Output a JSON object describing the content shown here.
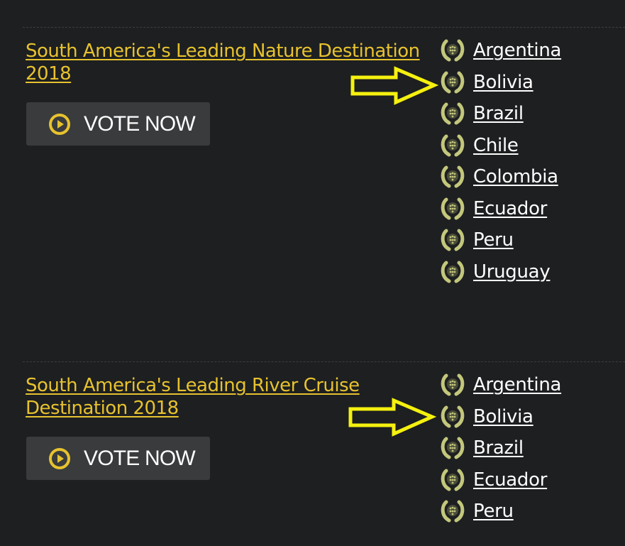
{
  "awards": [
    {
      "title": "South America's Leading Nature Destination 2018",
      "vote_label": "VOTE NOW",
      "countries": [
        "Argentina",
        "Bolivia",
        "Brazil",
        "Chile",
        "Colombia",
        "Ecuador",
        "Peru",
        "Uruguay"
      ]
    },
    {
      "title": "South America's Leading River Cruise Destination 2018",
      "vote_label": "VOTE NOW",
      "countries": [
        "Argentina",
        "Bolivia",
        "Brazil",
        "Ecuador",
        "Peru"
      ]
    }
  ],
  "colors": {
    "background": "#1d1f21",
    "title_gold": "#e7c22e",
    "button_bg": "#393b3d",
    "laurel_green": "#c3c77b",
    "arrow_yellow": "#f5f10f"
  },
  "icons": {
    "play": "play-circle-icon",
    "country_marker": "laurel-wreath-icon",
    "annotation": "arrow-right-icon"
  }
}
